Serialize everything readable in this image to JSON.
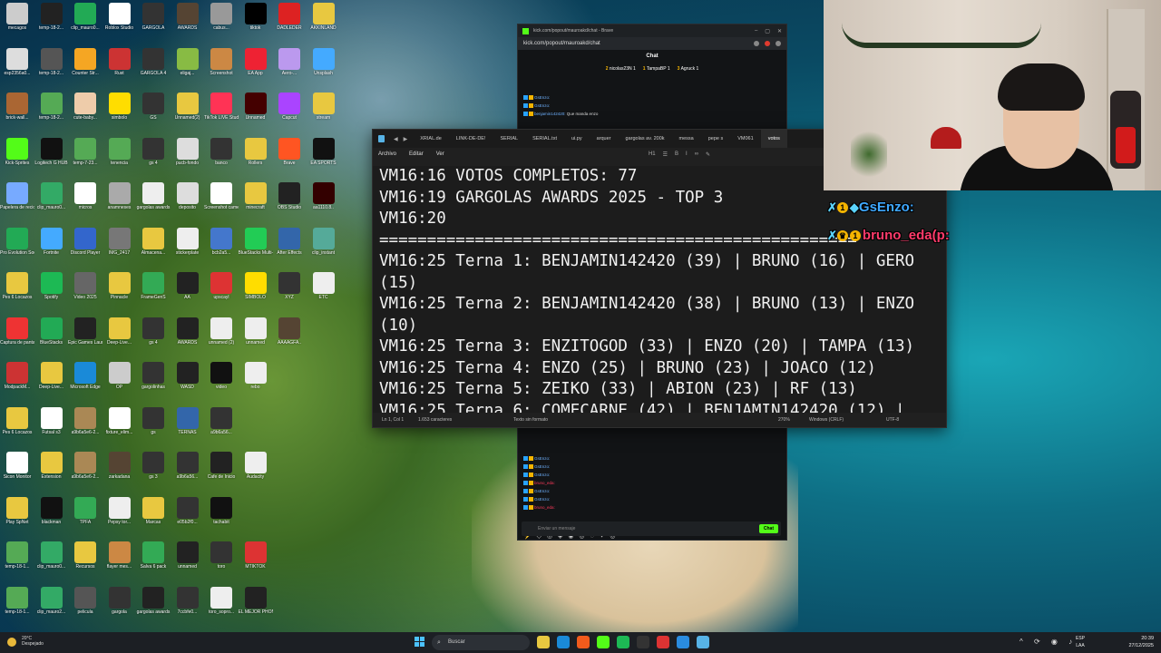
{
  "desktop": {
    "icons": [
      {
        "label": "mecagos",
        "color": "#ccc"
      },
      {
        "label": "temp-18-2...",
        "color": "#222"
      },
      {
        "label": "clip_mauro0...",
        "color": "#2a5"
      },
      {
        "label": "Roblox Studio",
        "color": "#fff"
      },
      {
        "label": "GARGOLA",
        "color": "#333"
      },
      {
        "label": "AWARDS",
        "color": "#543"
      },
      {
        "label": "cabus...",
        "color": "#999"
      },
      {
        "label": "tiktok",
        "color": "#000"
      },
      {
        "label": "DADLEDER",
        "color": "#d22"
      },
      {
        "label": "AKKINLAND",
        "color": "#e8c840"
      },
      {
        "label": "esp2356a0...",
        "color": "#ddd"
      },
      {
        "label": "temp-18-2...",
        "color": "#555"
      },
      {
        "label": "Counter Str...",
        "color": "#f5a623"
      },
      {
        "label": "Rust",
        "color": "#c33"
      },
      {
        "label": "GARGOLA 4",
        "color": "#333"
      },
      {
        "label": "eligaj...",
        "color": "#8b4"
      },
      {
        "label": "Screenshot",
        "color": "#c84"
      },
      {
        "label": "EA App",
        "color": "#e23"
      },
      {
        "label": "Aero-...",
        "color": "#b9e"
      },
      {
        "label": "Unsplash",
        "color": "#4af"
      },
      {
        "label": "brick-wall...",
        "color": "#a63"
      },
      {
        "label": "temp-18-2...",
        "color": "#5a5"
      },
      {
        "label": "cute-baby...",
        "color": "#eca"
      },
      {
        "label": "simbolo",
        "color": "#fd0"
      },
      {
        "label": "GS",
        "color": "#333"
      },
      {
        "label": "Unnamed(2)",
        "color": "#e8c840"
      },
      {
        "label": "TikTok LIVE Studio",
        "color": "#f35"
      },
      {
        "label": "Unnamed",
        "color": "#400"
      },
      {
        "label": "Capcut",
        "color": "#a4f"
      },
      {
        "label": "stream",
        "color": "#e8c840"
      },
      {
        "label": "Kick-Sprites",
        "color": "#53fc18"
      },
      {
        "label": "Logitech G HUB",
        "color": "#111"
      },
      {
        "label": "temp-7-23...",
        "color": "#5a5"
      },
      {
        "label": "tenencia",
        "color": "#5a5"
      },
      {
        "label": "gs 4",
        "color": "#333"
      },
      {
        "label": "pucb-fondo",
        "color": "#ddd"
      },
      {
        "label": "banco",
        "color": "#333"
      },
      {
        "label": "Rollers",
        "color": "#e8c840"
      },
      {
        "label": "Brave",
        "color": "#f52"
      },
      {
        "label": "EA SPORTS",
        "color": "#111"
      },
      {
        "label": "Papelera de reciclaje",
        "color": "#7af"
      },
      {
        "label": "clip_mauro0...",
        "color": "#3a6"
      },
      {
        "label": "micros",
        "color": "#fff"
      },
      {
        "label": "anamneses",
        "color": "#aaa"
      },
      {
        "label": "gargolas awards",
        "color": "#eee"
      },
      {
        "label": "deposito",
        "color": "#ddd"
      },
      {
        "label": "Screenshot camera",
        "color": "#fff"
      },
      {
        "label": "minecraft",
        "color": "#e8c840"
      },
      {
        "label": "OBS Studio",
        "color": "#222"
      },
      {
        "label": "aa1110.8..",
        "color": "#300"
      },
      {
        "label": "Pro Evolution Soccer",
        "color": "#2a5"
      },
      {
        "label": "Fortnite",
        "color": "#4af"
      },
      {
        "label": "Discord Player",
        "color": "#36c"
      },
      {
        "label": "IMG_2417",
        "color": "#777"
      },
      {
        "label": "Almacena...",
        "color": "#e8c840"
      },
      {
        "label": "stickerplate",
        "color": "#eee"
      },
      {
        "label": "bcb2a5...",
        "color": "#47c"
      },
      {
        "label": "BlueStacks Multi-Insta...",
        "color": "#2c5"
      },
      {
        "label": "After Effects",
        "color": "#36a"
      },
      {
        "label": "clip_instant",
        "color": "#5a9"
      },
      {
        "label": "Pes 6 Locazos",
        "color": "#e8c840"
      },
      {
        "label": "Spotify",
        "color": "#1db954"
      },
      {
        "label": "Video 2025",
        "color": "#666"
      },
      {
        "label": "Pinnacle",
        "color": "#e8c840"
      },
      {
        "label": "FrameGenS",
        "color": "#3a5"
      },
      {
        "label": "AA",
        "color": "#222"
      },
      {
        "label": "upscayl",
        "color": "#d33"
      },
      {
        "label": "SIMBOLO",
        "color": "#fd0"
      },
      {
        "label": "XYZ",
        "color": "#333"
      },
      {
        "label": "ETC",
        "color": "#eee"
      },
      {
        "label": "Captura de pantalla",
        "color": "#e33"
      },
      {
        "label": "BlueStacks",
        "color": "#2a5"
      },
      {
        "label": "Epic Games Launcher",
        "color": "#222"
      },
      {
        "label": "Deep-Live...",
        "color": "#e8c840"
      },
      {
        "label": "gs 4",
        "color": "#333"
      },
      {
        "label": "AWARDS",
        "color": "#222"
      },
      {
        "label": "unnamed (2)",
        "color": "#eee"
      },
      {
        "label": "unnamed",
        "color": "#eee"
      },
      {
        "label": "AAAAGFA..",
        "color": "#543"
      },
      {
        "label": "",
        "color": "transparent"
      },
      {
        "label": "ModpackM...",
        "color": "#c33"
      },
      {
        "label": "Deep-Live...",
        "color": "#e8c840"
      },
      {
        "label": "Microsoft Edge",
        "color": "#1a8ad8"
      },
      {
        "label": "OP",
        "color": "#ccc"
      },
      {
        "label": "gargolinhas",
        "color": "#333"
      },
      {
        "label": "WASD",
        "color": "#222"
      },
      {
        "label": "video",
        "color": "#111"
      },
      {
        "label": "rebo",
        "color": "#eee"
      },
      {
        "label": "",
        "color": "transparent"
      },
      {
        "label": "",
        "color": "transparent"
      },
      {
        "label": "Pes 6 Locazos",
        "color": "#e8c840"
      },
      {
        "label": "Futsal s3",
        "color": "#fff"
      },
      {
        "label": "a9b6a5e6-2...",
        "color": "#a85"
      },
      {
        "label": "fixture_elim...",
        "color": "#fff"
      },
      {
        "label": "gs",
        "color": "#333"
      },
      {
        "label": "TERNAS",
        "color": "#36a"
      },
      {
        "label": "a9b6a56...",
        "color": "#333"
      },
      {
        "label": "",
        "color": "transparent"
      },
      {
        "label": "",
        "color": "transparent"
      },
      {
        "label": "",
        "color": "transparent"
      },
      {
        "label": "Sicon Monitor",
        "color": "#fff"
      },
      {
        "label": "Extension",
        "color": "#e8c840"
      },
      {
        "label": "a9b6a5e6-2...",
        "color": "#a85"
      },
      {
        "label": "zarkadana",
        "color": "#543"
      },
      {
        "label": "gs 3",
        "color": "#333"
      },
      {
        "label": "a9b6a56...",
        "color": "#333"
      },
      {
        "label": "Cafe de Inicio",
        "color": "#222"
      },
      {
        "label": "Audacity",
        "color": "#eee"
      },
      {
        "label": "",
        "color": "transparent"
      },
      {
        "label": "",
        "color": "transparent"
      },
      {
        "label": "Play SpNet",
        "color": "#e8c840"
      },
      {
        "label": "blackman",
        "color": "#111"
      },
      {
        "label": "TPFA",
        "color": "#3a5"
      },
      {
        "label": "Pepsy tor...",
        "color": "#eee"
      },
      {
        "label": "Marcas",
        "color": "#e8c840"
      },
      {
        "label": "e05b2f0...",
        "color": "#333"
      },
      {
        "label": "tachabit",
        "color": "#111"
      },
      {
        "label": "",
        "color": "transparent"
      },
      {
        "label": "",
        "color": "transparent"
      },
      {
        "label": "",
        "color": "transparent"
      },
      {
        "label": "temp-18-1...",
        "color": "#5a5"
      },
      {
        "label": "clip_mauro0...",
        "color": "#3a6"
      },
      {
        "label": "Recursos",
        "color": "#e8c840"
      },
      {
        "label": "flayer mes...",
        "color": "#c84"
      },
      {
        "label": "Salva 6 pack",
        "color": "#3a5"
      },
      {
        "label": "unnamed",
        "color": "#222"
      },
      {
        "label": "toro",
        "color": "#333"
      },
      {
        "label": "MTIKTOK",
        "color": "#d33"
      },
      {
        "label": "",
        "color": "transparent"
      },
      {
        "label": "",
        "color": "transparent"
      },
      {
        "label": "temp-18-1...",
        "color": "#5a5"
      },
      {
        "label": "clip_mauro2...",
        "color": "#3a6"
      },
      {
        "label": "pelicula",
        "color": "#555"
      },
      {
        "label": "gargola",
        "color": "#333"
      },
      {
        "label": "gargolas awards",
        "color": "#222"
      },
      {
        "label": "7ccbfe0...",
        "color": "#333"
      },
      {
        "label": "toro_sopro...",
        "color": "#eee"
      },
      {
        "label": "EL MEJOR PHONK",
        "color": "#222"
      },
      {
        "label": "",
        "color": "transparent"
      },
      {
        "label": "",
        "color": "transparent"
      }
    ]
  },
  "kick_popup": {
    "title": "kick.com/popout/mauroakd/chat - Brave",
    "url": "kick.com/popout/mauroakd/chat",
    "header": "Chat",
    "podium": [
      {
        "rank": "2",
        "name": "nicolas23N",
        "count": "1"
      },
      {
        "rank": "1",
        "name": "TampaBP",
        "count": "1"
      },
      {
        "rank": "3",
        "name": "Agruck",
        "count": "1"
      }
    ],
    "messages_top": [
      {
        "name": "GsEnzo:",
        "text": ""
      },
      {
        "name": "GsEnzo:",
        "text": ""
      },
      {
        "name": "benjamin142420:",
        "text": "Que manda enzo"
      }
    ],
    "messages_bottom": [
      {
        "name": "GsEnzo:",
        "red": false
      },
      {
        "name": "GsEnzo:",
        "red": false
      },
      {
        "name": "GsEnzo:",
        "red": false
      },
      {
        "name": "bruno_eda:",
        "red": true
      },
      {
        "name": "GsEnzo:",
        "red": false
      },
      {
        "name": "GsEnzo:",
        "red": false
      },
      {
        "name": "bruno_eda:",
        "red": true
      }
    ],
    "emotes": "⚡ ◇ ◎ ◈ ◉ ◎ ◌ ✦ ◎",
    "input_placeholder": "Enviar un mensaje",
    "send_label": "Chat"
  },
  "notepad": {
    "tabs": [
      "XRIAL.de",
      "LINK-DE-DE!",
      "SERIAL",
      "SERIAL.txt",
      "ui.py",
      "arquer",
      "gargolas av.  200k",
      "messa",
      "pepe s",
      "VM061",
      "votos"
    ],
    "active_tab": 10,
    "menu": {
      "file": "Archivo",
      "edit": "Editar",
      "view": "Ver"
    },
    "tools": [
      "H1",
      "☰",
      "B",
      "I",
      "∞",
      "✎"
    ],
    "lines": [
      "VM16:16 VOTOS COMPLETOS: 77",
      "VM16:19 GARGOLAS AWARDS 2025 - TOP 3",
      "VM16:20",
      "==================================================",
      "VM16:25 Terna 1: BENJAMIN142420 (39) | BRUNO (16) | GERO",
      "(15)",
      "VM16:25 Terna 2: BENJAMIN142420 (38) | BRUNO (13) | ENZO",
      "(10)",
      "VM16:25 Terna 3: ENZITOGOD (33) | ENZO (20) | TAMPA (13)",
      "VM16:25 Terna 4: ENZO (25) | BRUNO (23) | JOACO (12)",
      "VM16:25 Terna 5: ZEIKO (33) | ABION (23) | RF (13)",
      "VM16:25 Terna 6: COMECARNE (42) | BENJAMIN142420 (12) |"
    ],
    "status": {
      "position": "Ln 1, Col 1",
      "chars": "1.653 caracteres",
      "format": "Texto sin formato",
      "zoom": "270%",
      "eol": "Windows (CRLF)",
      "encoding": "UTF-8"
    }
  },
  "overlay_chat": [
    {
      "name": "GsEnzo:",
      "color": "blue"
    },
    {
      "name": "bruno_eda(p:",
      "color": "red"
    }
  ],
  "taskbar": {
    "weather_temp": "20°C",
    "weather_desc": "Despejado",
    "search_placeholder": "Buscar",
    "lang_top": "ESP",
    "lang_bottom": "LAA",
    "time": "20:39",
    "date": "27/12/2025",
    "apps": [
      {
        "name": "file-explorer-icon",
        "color": "#e8c840"
      },
      {
        "name": "edge-icon",
        "color": "#1a8ad8"
      },
      {
        "name": "brave-icon",
        "color": "#f25b1c"
      },
      {
        "name": "kick-icon",
        "color": "#53fc18"
      },
      {
        "name": "spotify-icon",
        "color": "#1db954"
      },
      {
        "name": "obs-icon",
        "color": "#333"
      },
      {
        "name": "app-icon",
        "color": "#d33"
      },
      {
        "name": "vscode-icon",
        "color": "#2a8ce0"
      },
      {
        "name": "notepad-icon",
        "color": "#57b3e6"
      }
    ]
  }
}
